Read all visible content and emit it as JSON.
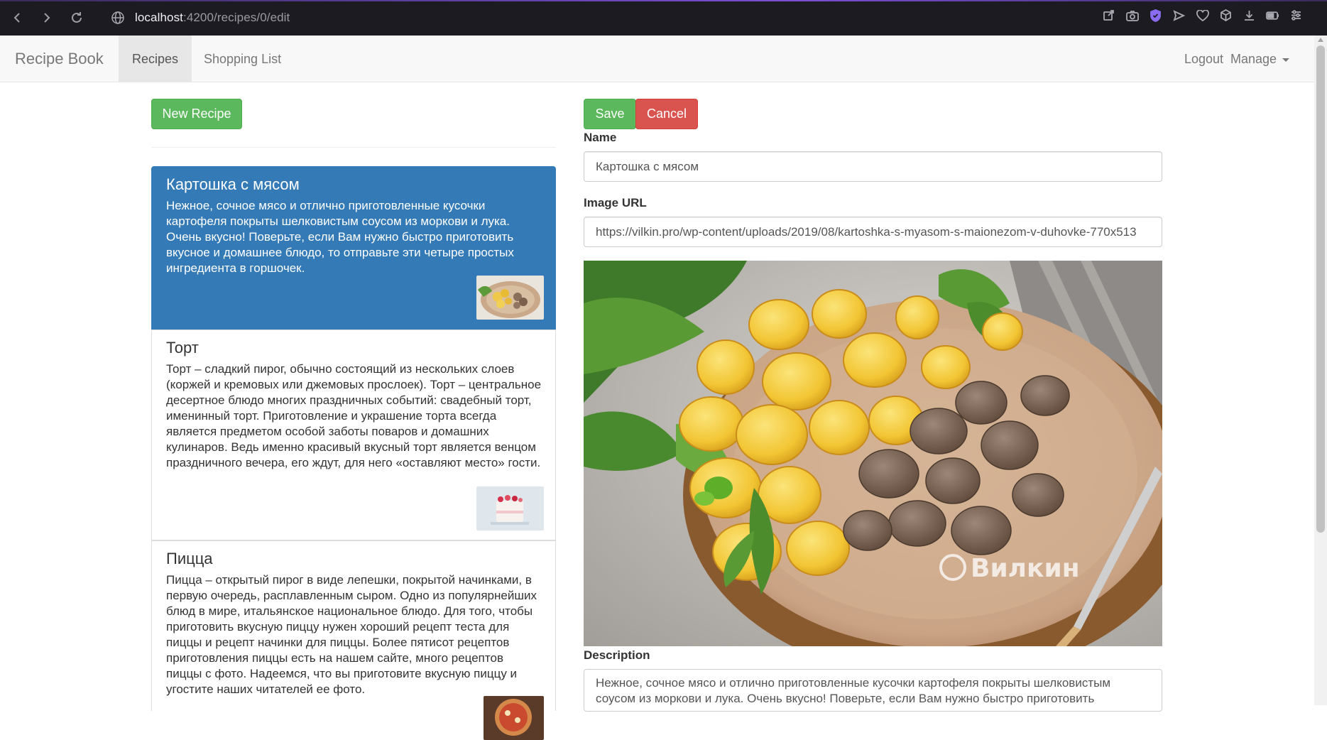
{
  "browser": {
    "url_host": "localhost",
    "url_path": ":4200/recipes/0/edit"
  },
  "navbar": {
    "brand": "Recipe Book",
    "items": [
      {
        "label": "Recipes",
        "active": true
      },
      {
        "label": "Shopping List",
        "active": false
      }
    ],
    "logout": "Logout",
    "manage": "Manage"
  },
  "list_panel": {
    "new_recipe_label": "New Recipe"
  },
  "recipes": [
    {
      "name": "Картошка с мясом",
      "description": "Нежное, сочное мясо и отлично приготовленные кусочки картофеля покрыты шелковистым соусом из моркови и лука. Очень вкусно! Поверьте, если Вам нужно быстро приготовить вкусное и домашнее блюдо, то отправьте эти четыре простых ингредиента в горшочек.",
      "thumb": "potatoes-with-meat"
    },
    {
      "name": "Торт",
      "description": "Торт – сладкий пирог, обычно состоящий из нескольких слоев (коржей и кремовых или джемовых прослоек). Торт – центральное десертное блюдо многих праздничных событий: свадебный торт, именинный торт. Приготовление и украшение торта всегда является предметом особой заботы поваров и домашних кулинаров. Ведь именно красивый вкусный торт является венцом праздничного вечера, его ждут, для него «оставляют место» гости.",
      "thumb": "cake"
    },
    {
      "name": "Пицца",
      "description": "Пицца – открытый пирог в виде лепешки, покрытой начинками, в первую очередь, расплавленным сыром. Одно из популярнейших блюд в мире, итальянское национальное блюдо. Для того, чтобы приготовить вкусную пиццу нужен хороший рецепт теста для пиццы и рецепт начинки для пиццы. Более пятисот рецептов приготовления пиццы есть на нашем сайте, много рецептов пиццы с фото. Надеемся, что вы приготовите вкусную пиццу и угостите наших читателей ее фото.",
      "thumb": "pizza"
    }
  ],
  "form": {
    "save_label": "Save",
    "cancel_label": "Cancel",
    "name_label": "Name",
    "name_value": "Картошка с мясом",
    "image_url_label": "Image URL",
    "image_url_value": "https://vilkin.pro/wp-content/uploads/2019/08/kartoshka-s-myasom-s-maionezom-v-duhovke-770x513",
    "description_label": "Description",
    "description_value": "Нежное, сочное мясо и отлично приготовленные кусочки картофеля покрыты шелковистым соусом из моркови и лука. Очень вкусно! Поверьте, если Вам нужно быстро приготовить",
    "watermark": "Вилкин"
  },
  "colors": {
    "primary": "#337ab7",
    "success": "#5cb85c",
    "danger": "#d9534f"
  }
}
